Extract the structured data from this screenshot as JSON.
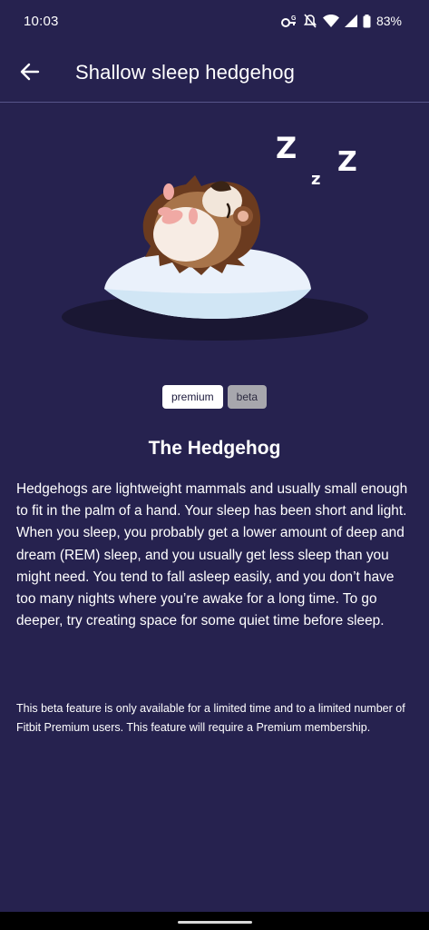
{
  "status_bar": {
    "time": "10:03",
    "battery": "83%",
    "icons": [
      "key-icon",
      "notifications-off-icon",
      "wifi-icon",
      "signal-icon",
      "battery-icon"
    ]
  },
  "app_bar": {
    "back_icon": "arrow-left-icon",
    "title": "Shallow sleep hedgehog"
  },
  "illustration": {
    "subject": "sleeping-hedgehog-on-pillow",
    "zzz": [
      "Z",
      "z",
      "Z"
    ]
  },
  "badges": {
    "premium": "premium",
    "beta": "beta"
  },
  "content": {
    "heading": "The Hedgehog",
    "description": "Hedgehogs are lightweight mammals and usually small enough to fit in the palm of a hand. Your sleep has been short and light. When you sleep, you probably get a lower amount of deep and dream (REM) sleep, and you usually get less sleep than you might need. You tend to fall asleep easily, and you don’t have too many nights where you’re awake for a long time. To go deeper, try creating space for some quiet time before sleep.",
    "disclaimer": "This beta feature is only available for a limited time and to a limited number of Fitbit Premium users. This feature will require a Premium membership."
  },
  "colors": {
    "background": "#26224f",
    "divider": "#57548a",
    "premium_badge": "#ffffff",
    "beta_badge": "#a7a7ad"
  }
}
